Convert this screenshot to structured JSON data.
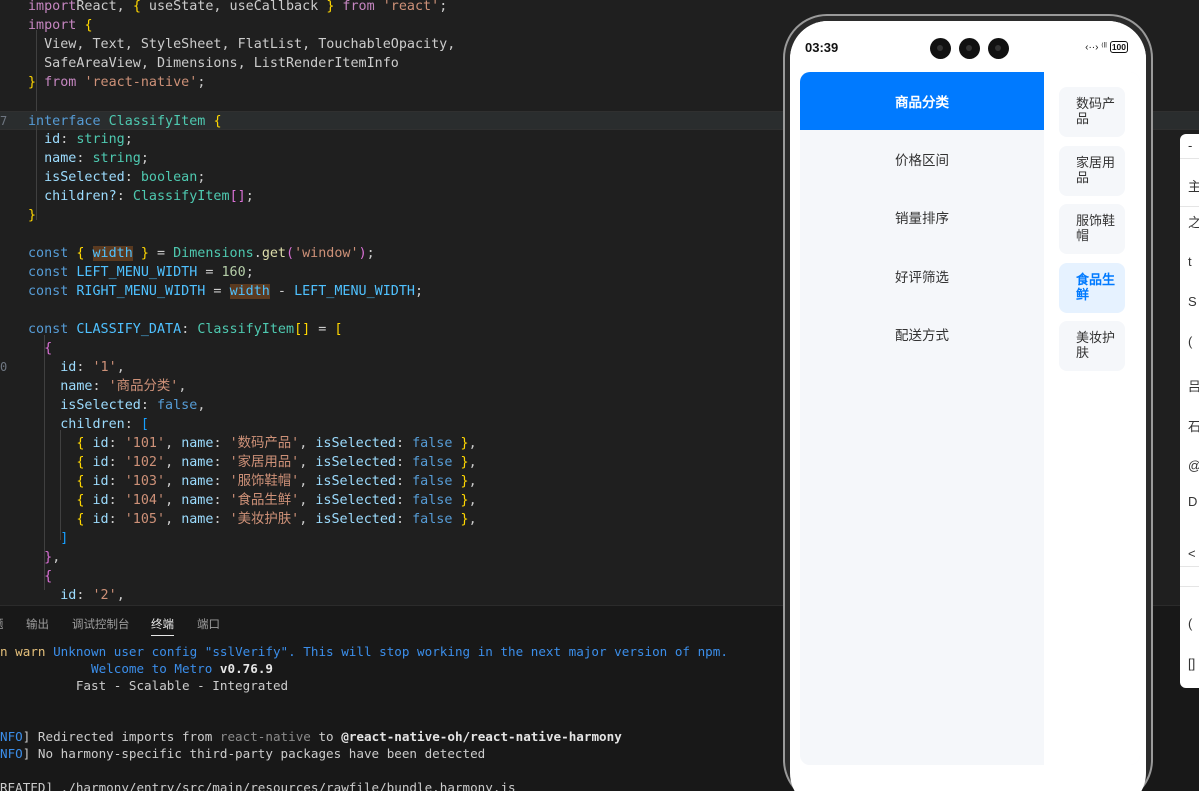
{
  "editor": {
    "lines": [
      {
        "ln": "",
        "segs": [
          [
            "kw2",
            "import"
          ],
          [
            "",
            "React, "
          ],
          [
            "p1",
            "{"
          ],
          [
            "",
            " useState, useCallback "
          ],
          [
            "p1",
            "}"
          ],
          [
            "kw2",
            " from "
          ],
          [
            "st",
            "'react'"
          ],
          [
            "",
            ";"
          ]
        ]
      },
      {
        "ln": "",
        "segs": [
          [
            "kw2",
            "import"
          ],
          [
            "",
            " "
          ],
          [
            "p1",
            "{"
          ]
        ]
      },
      {
        "ln": "",
        "segs": [
          [
            "",
            "  View, Text, StyleSheet, FlatList, TouchableOpacity,"
          ]
        ]
      },
      {
        "ln": "",
        "segs": [
          [
            "",
            "  SafeAreaView, Dimensions, ListRenderItemInfo"
          ]
        ]
      },
      {
        "ln": "",
        "segs": [
          [
            "p1",
            "}"
          ],
          [
            "kw2",
            " from "
          ],
          [
            "st",
            "'react-native'"
          ],
          [
            "",
            ";"
          ]
        ]
      },
      {
        "ln": "",
        "segs": []
      },
      {
        "ln": "7",
        "segs": [
          [
            "kw",
            "interface "
          ],
          [
            "ty",
            "ClassifyItem"
          ],
          [
            "",
            " "
          ],
          [
            "p1",
            "{"
          ]
        ]
      },
      {
        "ln": "",
        "segs": [
          [
            "id",
            "  id"
          ],
          [
            "",
            ": "
          ],
          [
            "ty",
            "string"
          ],
          [
            "",
            ";"
          ]
        ]
      },
      {
        "ln": "",
        "segs": [
          [
            "id",
            "  name"
          ],
          [
            "",
            ": "
          ],
          [
            "ty",
            "string"
          ],
          [
            "",
            ";"
          ]
        ]
      },
      {
        "ln": "",
        "segs": [
          [
            "id",
            "  isSelected"
          ],
          [
            "",
            ": "
          ],
          [
            "ty",
            "boolean"
          ],
          [
            "",
            ";"
          ]
        ]
      },
      {
        "ln": "",
        "segs": [
          [
            "id",
            "  children?"
          ],
          [
            "",
            ": "
          ],
          [
            "ty",
            "ClassifyItem"
          ],
          [
            "p2",
            "[]"
          ],
          [
            "",
            ";"
          ]
        ]
      },
      {
        "ln": "",
        "segs": [
          [
            "p1",
            "}"
          ]
        ]
      },
      {
        "ln": "",
        "segs": []
      },
      {
        "ln": "",
        "segs": [
          [
            "kw",
            "const "
          ],
          [
            "p1",
            "{"
          ],
          [
            "",
            " "
          ],
          [
            "cn mark",
            "width"
          ],
          [
            "",
            " "
          ],
          [
            "p1",
            "}"
          ],
          [
            "",
            " = "
          ],
          [
            "ty",
            "Dimensions"
          ],
          [
            "",
            "."
          ],
          [
            "fn",
            "get"
          ],
          [
            "p2",
            "("
          ],
          [
            "st",
            "'window'"
          ],
          [
            "p2",
            ")"
          ],
          [
            "",
            ";"
          ]
        ]
      },
      {
        "ln": "",
        "segs": [
          [
            "kw",
            "const "
          ],
          [
            "cn",
            "LEFT_MENU_WIDTH"
          ],
          [
            "",
            " = "
          ],
          [
            "nu",
            "160"
          ],
          [
            "",
            ";"
          ]
        ]
      },
      {
        "ln": "",
        "segs": [
          [
            "kw",
            "const "
          ],
          [
            "cn",
            "RIGHT_MENU_WIDTH"
          ],
          [
            "",
            " = "
          ],
          [
            "cn mark",
            "width"
          ],
          [
            "",
            " - "
          ],
          [
            "cn",
            "LEFT_MENU_WIDTH"
          ],
          [
            "",
            ";"
          ]
        ]
      },
      {
        "ln": "",
        "segs": []
      },
      {
        "ln": "",
        "segs": [
          [
            "kw",
            "const "
          ],
          [
            "cn",
            "CLASSIFY_DATA"
          ],
          [
            "",
            ": "
          ],
          [
            "ty",
            "ClassifyItem"
          ],
          [
            "p1",
            "[]"
          ],
          [
            "",
            " = "
          ],
          [
            "p1",
            "["
          ]
        ]
      },
      {
        "ln": "",
        "segs": [
          [
            "",
            "  "
          ],
          [
            "p2",
            "{"
          ]
        ]
      },
      {
        "ln": "0",
        "segs": [
          [
            "id",
            "    id"
          ],
          [
            "",
            ": "
          ],
          [
            "st",
            "'1'"
          ],
          [
            "",
            ","
          ]
        ]
      },
      {
        "ln": "",
        "segs": [
          [
            "id",
            "    name"
          ],
          [
            "",
            ": "
          ],
          [
            "st",
            "'商品分类'"
          ],
          [
            "",
            ","
          ]
        ]
      },
      {
        "ln": "",
        "segs": [
          [
            "id",
            "    isSelected"
          ],
          [
            "",
            ": "
          ],
          [
            "kw",
            "false"
          ],
          [
            "",
            ","
          ]
        ]
      },
      {
        "ln": "",
        "segs": [
          [
            "id",
            "    children"
          ],
          [
            "",
            ": "
          ],
          [
            "p3",
            "["
          ]
        ]
      },
      {
        "ln": "",
        "segs": [
          [
            "",
            "      "
          ],
          [
            "p1",
            "{"
          ],
          [
            "id",
            " id"
          ],
          [
            "",
            ": "
          ],
          [
            "st",
            "'101'"
          ],
          [
            "",
            ", "
          ],
          [
            "id",
            "name"
          ],
          [
            "",
            ": "
          ],
          [
            "st",
            "'数码产品'"
          ],
          [
            "",
            ", "
          ],
          [
            "id",
            "isSelected"
          ],
          [
            "",
            ": "
          ],
          [
            "kw",
            "false"
          ],
          [
            "",
            " "
          ],
          [
            "p1",
            "}"
          ],
          [
            "",
            ","
          ]
        ]
      },
      {
        "ln": "",
        "segs": [
          [
            "",
            "      "
          ],
          [
            "p1",
            "{"
          ],
          [
            "id",
            " id"
          ],
          [
            "",
            ": "
          ],
          [
            "st",
            "'102'"
          ],
          [
            "",
            ", "
          ],
          [
            "id",
            "name"
          ],
          [
            "",
            ": "
          ],
          [
            "st",
            "'家居用品'"
          ],
          [
            "",
            ", "
          ],
          [
            "id",
            "isSelected"
          ],
          [
            "",
            ": "
          ],
          [
            "kw",
            "false"
          ],
          [
            "",
            " "
          ],
          [
            "p1",
            "}"
          ],
          [
            "",
            ","
          ]
        ]
      },
      {
        "ln": "",
        "segs": [
          [
            "",
            "      "
          ],
          [
            "p1",
            "{"
          ],
          [
            "id",
            " id"
          ],
          [
            "",
            ": "
          ],
          [
            "st",
            "'103'"
          ],
          [
            "",
            ", "
          ],
          [
            "id",
            "name"
          ],
          [
            "",
            ": "
          ],
          [
            "st",
            "'服饰鞋帽'"
          ],
          [
            "",
            ", "
          ],
          [
            "id",
            "isSelected"
          ],
          [
            "",
            ": "
          ],
          [
            "kw",
            "false"
          ],
          [
            "",
            " "
          ],
          [
            "p1",
            "}"
          ],
          [
            "",
            ","
          ]
        ]
      },
      {
        "ln": "",
        "segs": [
          [
            "",
            "      "
          ],
          [
            "p1",
            "{"
          ],
          [
            "id",
            " id"
          ],
          [
            "",
            ": "
          ],
          [
            "st",
            "'104'"
          ],
          [
            "",
            ", "
          ],
          [
            "id",
            "name"
          ],
          [
            "",
            ": "
          ],
          [
            "st",
            "'食品生鲜'"
          ],
          [
            "",
            ", "
          ],
          [
            "id",
            "isSelected"
          ],
          [
            "",
            ": "
          ],
          [
            "kw",
            "false"
          ],
          [
            "",
            " "
          ],
          [
            "p1",
            "}"
          ],
          [
            "",
            ","
          ]
        ]
      },
      {
        "ln": "",
        "segs": [
          [
            "",
            "      "
          ],
          [
            "p1",
            "{"
          ],
          [
            "id",
            " id"
          ],
          [
            "",
            ": "
          ],
          [
            "st",
            "'105'"
          ],
          [
            "",
            ", "
          ],
          [
            "id",
            "name"
          ],
          [
            "",
            ": "
          ],
          [
            "st",
            "'美妆护肤'"
          ],
          [
            "",
            ", "
          ],
          [
            "id",
            "isSelected"
          ],
          [
            "",
            ": "
          ],
          [
            "kw",
            "false"
          ],
          [
            "",
            " "
          ],
          [
            "p1",
            "}"
          ],
          [
            "",
            ","
          ]
        ]
      },
      {
        "ln": "",
        "segs": [
          [
            "",
            "    "
          ],
          [
            "p3",
            "]"
          ]
        ]
      },
      {
        "ln": "",
        "segs": [
          [
            "",
            "  "
          ],
          [
            "p2",
            "}"
          ],
          [
            "",
            ","
          ]
        ]
      },
      {
        "ln": "",
        "segs": [
          [
            "",
            "  "
          ],
          [
            "p2",
            "{"
          ]
        ]
      },
      {
        "ln": "",
        "segs": [
          [
            "id",
            "    id"
          ],
          [
            "",
            ": "
          ],
          [
            "st",
            "'2'"
          ],
          [
            "",
            ","
          ]
        ]
      }
    ]
  },
  "panel": {
    "tabs": [
      {
        "label": "题"
      },
      {
        "label": "输出"
      },
      {
        "label": "调试控制台"
      },
      {
        "label": "终端"
      },
      {
        "label": "端口"
      }
    ],
    "terminal": [
      {
        "segs": [
          [
            "t-warn",
            "n warn"
          ],
          [
            "",
            " "
          ],
          [
            "t-blue",
            "Unknown user config \"sslVerify\". This will stop working in the next major version of npm."
          ]
        ]
      },
      {
        "segs": [
          [
            "",
            "            "
          ],
          [
            "t-blue",
            "Welcome to Metro "
          ],
          [
            "t-white",
            "v0.76.9"
          ]
        ]
      },
      {
        "segs": [
          [
            "",
            "          Fast - Scalable - Integrated"
          ]
        ]
      },
      {
        "segs": []
      },
      {
        "segs": []
      },
      {
        "segs": [
          [
            "t-blue",
            "NFO"
          ],
          [
            "",
            "] Redirected imports from "
          ],
          [
            "t-dim",
            "react-native"
          ],
          [
            "",
            " to "
          ],
          [
            "t-white",
            "@react-native-oh/react-native-harmony"
          ]
        ]
      },
      {
        "segs": [
          [
            "t-blue",
            "NFO"
          ],
          [
            "",
            "] No harmony-specific third-party packages have been detected"
          ]
        ]
      },
      {
        "segs": []
      },
      {
        "segs": [
          [
            "",
            "REATED] ./harmony/entry/src/main/resources/rawfile/bundle.harmony.js"
          ]
        ]
      }
    ]
  },
  "phone": {
    "status": {
      "time": "03:39",
      "signal": "‹··› ⁽ˡˡ",
      "battery": "100"
    },
    "left_menu": [
      {
        "label": "商品分类",
        "selected": true
      },
      {
        "label": "价格区间",
        "selected": false
      },
      {
        "label": "销量排序",
        "selected": false
      },
      {
        "label": "好评筛选",
        "selected": false
      },
      {
        "label": "配送方式",
        "selected": false
      }
    ],
    "right_menu": [
      {
        "label": "数码产品",
        "selected": false
      },
      {
        "label": "家居用品",
        "selected": false
      },
      {
        "label": "服饰鞋帽",
        "selected": false
      },
      {
        "label": "食品生鲜",
        "selected": true
      },
      {
        "label": "美妆护肤",
        "selected": false
      }
    ]
  },
  "side_window": {
    "rows": [
      "-",
      "主",
      "之",
      "t",
      "S",
      "(",
      "吕",
      "石",
      "@",
      "D",
      "<",
      "(",
      "[]"
    ]
  }
}
